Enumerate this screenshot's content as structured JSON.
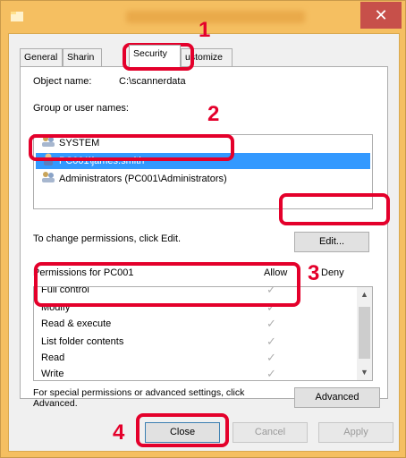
{
  "window": {
    "title": "",
    "close_glyph": "✕"
  },
  "tabs": [
    "General",
    "Sharin",
    "Security",
    "ustomize"
  ],
  "object_name": {
    "label": "Object name:",
    "value": "C:\\scannerdata"
  },
  "groups": {
    "label": "Group or user names:",
    "items": [
      "SYSTEM",
      "PC001\\james.smith",
      "Administrators (PC001\\Administrators)"
    ]
  },
  "change_permissions_text": "To change permissions, click Edit.",
  "edit_button": "Edit...",
  "permissions": {
    "header": "Permissions for PC001",
    "allow_header": "Allow",
    "deny_header": "Deny",
    "rows": [
      "Full control",
      "Modify",
      "Read & execute",
      "List folder contents",
      "Read",
      "Write"
    ],
    "allow_checks": [
      true,
      true,
      true,
      true,
      true,
      true
    ]
  },
  "special_text": "For special permissions or advanced settings, click Advanced.",
  "advanced_button": "Advanced",
  "buttons": {
    "close": "Close",
    "cancel": "Cancel",
    "apply": "Apply"
  },
  "callouts": [
    "1",
    "2",
    "3",
    "4"
  ],
  "accent_color": "#e4002b",
  "selection_color": "#3399ff"
}
